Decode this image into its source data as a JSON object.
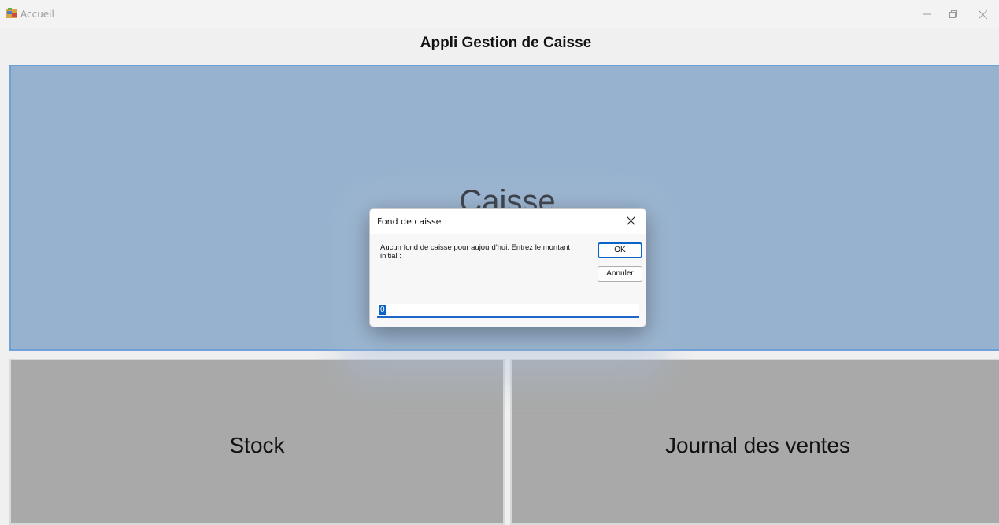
{
  "window": {
    "title": "Accueil",
    "icon": "app-window-icon",
    "controls": [
      "minimize-icon",
      "restore-icon",
      "close-icon"
    ]
  },
  "header": {
    "title": "Appli Gestion de Caisse"
  },
  "main": {
    "caisse_label": "Caisse",
    "stock_label": "Stock",
    "journal_label": "Journal des ventes"
  },
  "dialog": {
    "title": "Fond de caisse",
    "message": "Aucun fond de caisse pour aujourd'hui. Entrez le montant initial :",
    "ok_label": "OK",
    "cancel_label": "Annuler",
    "input_value": "0"
  },
  "colors": {
    "caisse_bg": "#96b2ce",
    "tile_bg": "#a9a9a9",
    "focus_accent": "#0a64c8"
  }
}
